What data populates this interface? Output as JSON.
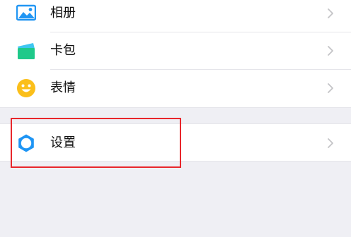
{
  "menu": {
    "items": [
      {
        "label": "相册",
        "icon": "photo-album-icon",
        "accent": "#2196f3"
      },
      {
        "label": "卡包",
        "icon": "card-wallet-icon",
        "accent": "#1fc98a"
      },
      {
        "label": "表情",
        "icon": "emoji-smile-icon",
        "accent": "#fbbf1a"
      }
    ],
    "settings": {
      "label": "设置",
      "icon": "gear-icon",
      "accent": "#1e95f4"
    }
  },
  "annotation": {
    "highlight_color": "#e8262b",
    "highlighted_item": "设置"
  }
}
